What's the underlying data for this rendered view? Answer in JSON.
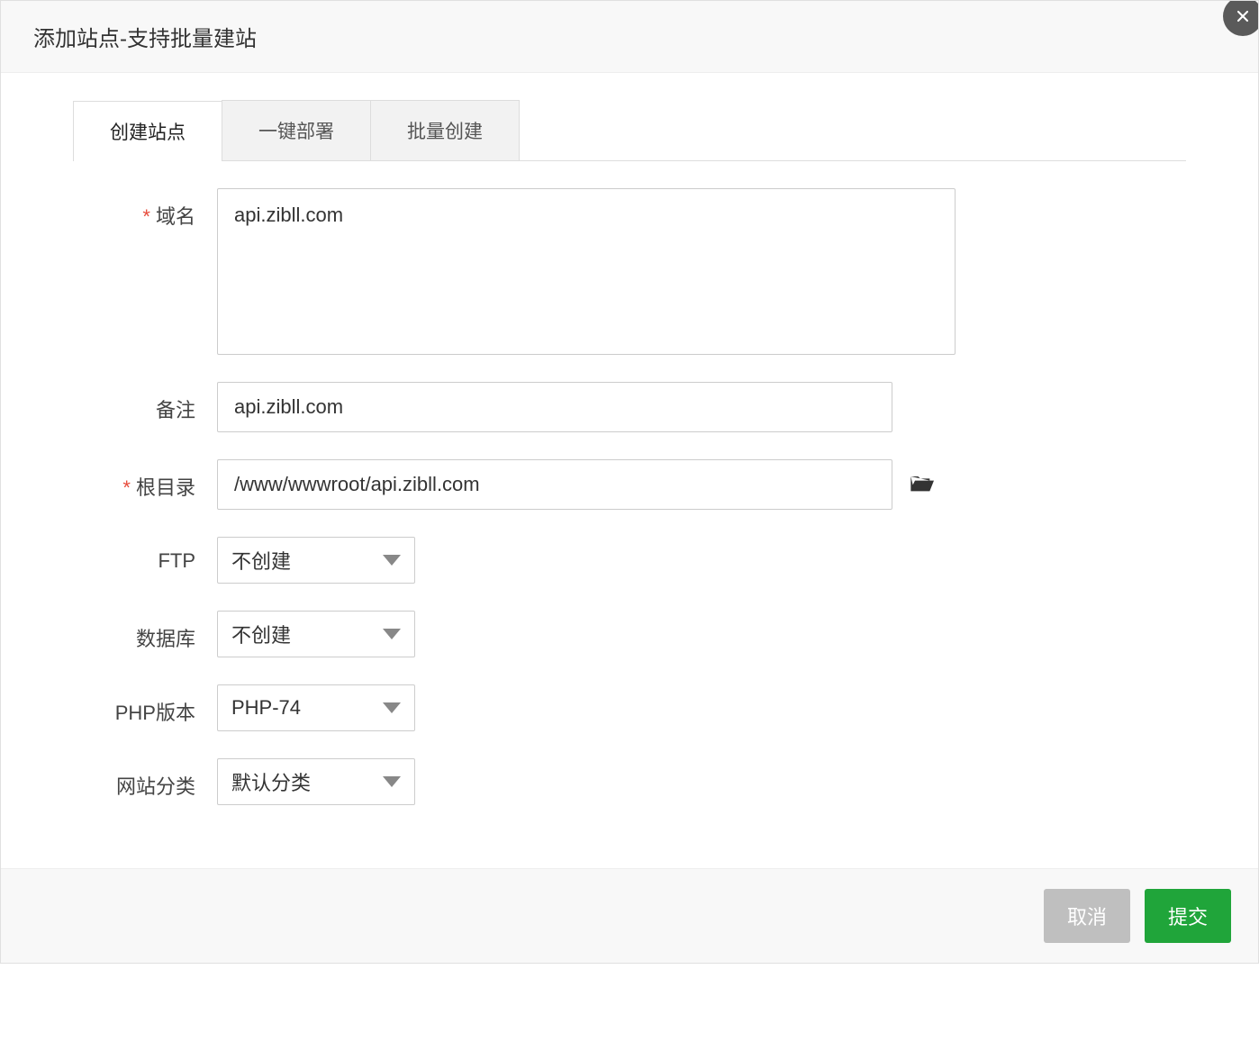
{
  "modal": {
    "title": "添加站点-支持批量建站"
  },
  "tabs": [
    {
      "label": "创建站点",
      "active": true
    },
    {
      "label": "一键部署",
      "active": false
    },
    {
      "label": "批量创建",
      "active": false
    }
  ],
  "form": {
    "domain": {
      "label": "域名",
      "value": "api.zibll.com",
      "required": true
    },
    "remark": {
      "label": "备注",
      "value": "api.zibll.com",
      "required": false
    },
    "root": {
      "label": "根目录",
      "value": "/www/wwwroot/api.zibll.com",
      "required": true
    },
    "ftp": {
      "label": "FTP",
      "value": "不创建"
    },
    "database": {
      "label": "数据库",
      "value": "不创建"
    },
    "php": {
      "label": "PHP版本",
      "value": "PHP-74"
    },
    "category": {
      "label": "网站分类",
      "value": "默认分类"
    }
  },
  "footer": {
    "cancel": "取消",
    "submit": "提交"
  }
}
